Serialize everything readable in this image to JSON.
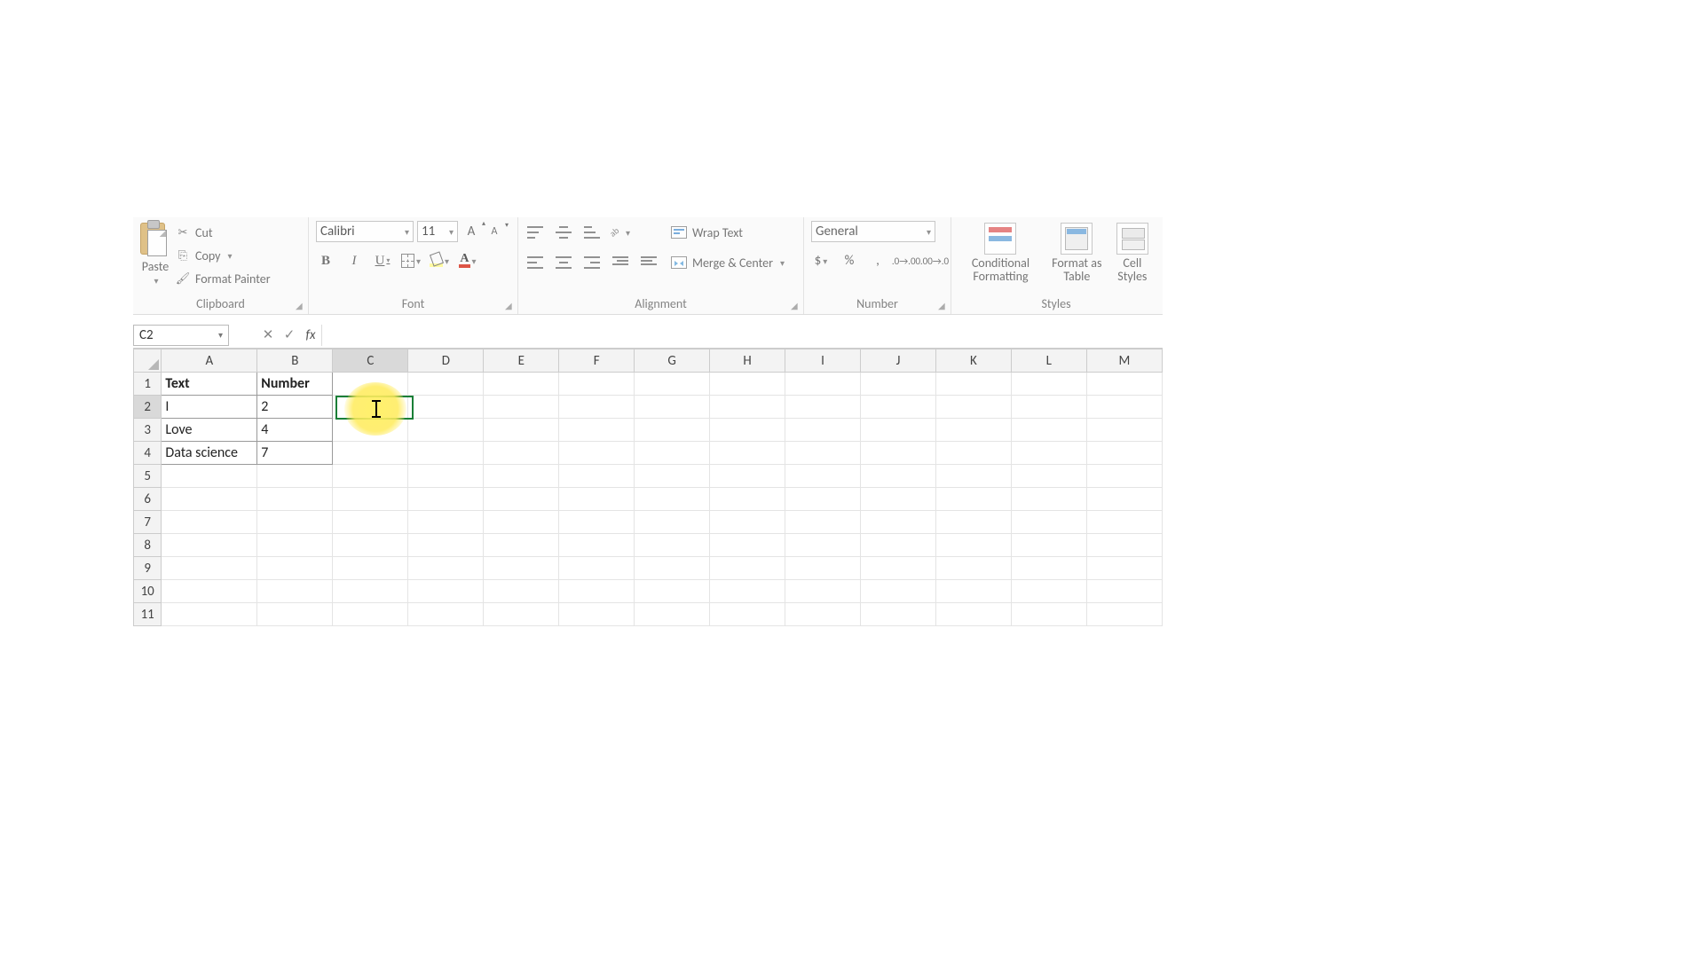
{
  "ribbon": {
    "clipboard": {
      "paste": "Paste",
      "cut": "Cut",
      "copy": "Copy",
      "format_painter": "Format Painter",
      "group": "Clipboard"
    },
    "font": {
      "name": "Calibri",
      "size": "11",
      "group": "Font",
      "fontcolor_letter": "A",
      "grow_letter": "A",
      "shrink_letter": "A"
    },
    "alignment": {
      "wrap": "Wrap Text",
      "merge": "Merge & Center",
      "group": "Alignment"
    },
    "number": {
      "format": "General",
      "group": "Number"
    },
    "styles": {
      "conditional": "Conditional Formatting",
      "format_as_table": "Format as Table",
      "cell_styles": "Cell Styles",
      "group": "Styles"
    }
  },
  "formula_bar": {
    "name_box": "C2",
    "fx": "fx",
    "value": ""
  },
  "grid": {
    "columns": [
      "A",
      "B",
      "C",
      "D",
      "E",
      "F",
      "G",
      "H",
      "I",
      "J",
      "K",
      "L",
      "M"
    ],
    "col_widths": {
      "A": 110,
      "B": 86,
      "C": 88,
      "default": 88
    },
    "row_headers": [
      "1",
      "2",
      "3",
      "4",
      "5",
      "6",
      "7",
      "8",
      "9",
      "10",
      "11"
    ],
    "active_cell": "C2",
    "active_col": "C",
    "active_row": "2",
    "data_range": {
      "rows": 4,
      "cols": 2
    },
    "cells": {
      "A1": "Text",
      "B1": "Number",
      "A2": "I",
      "B2": "2",
      "A3": "Love",
      "B3": "4",
      "A4": "Data science",
      "B4": "7"
    }
  }
}
